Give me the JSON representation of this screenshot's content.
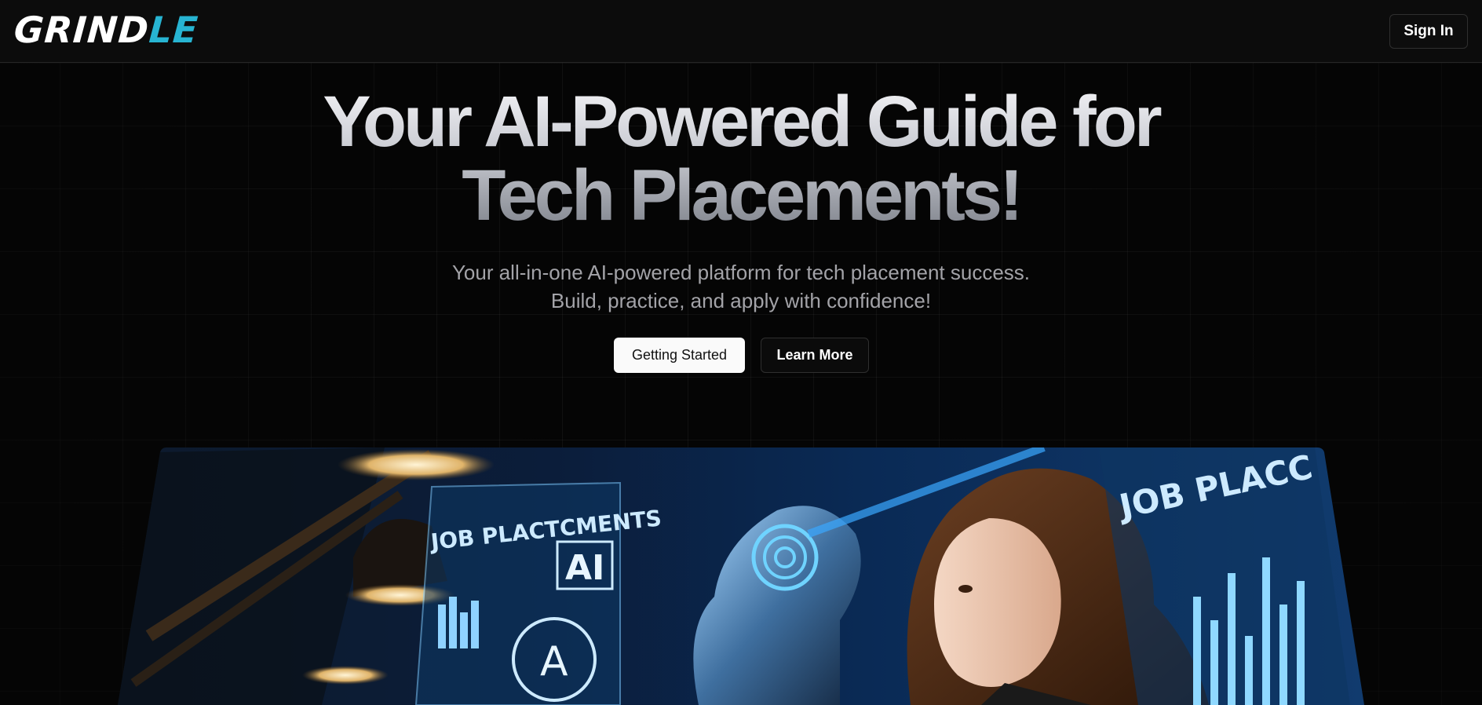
{
  "brand": {
    "logo_part1": "GRIND",
    "logo_part2": "LE",
    "accent": "#27b4d2"
  },
  "header": {
    "sign_in_label": "Sign In"
  },
  "hero": {
    "title_line1": "Your AI-Powered Guide for",
    "title_line2": "Tech Placements!",
    "subtitle_line1": "Your all-in-one AI-powered platform for tech placement success.",
    "subtitle_line2": "Build, practice, and apply with confidence!",
    "primary_button": "Getting Started",
    "secondary_button": "Learn More"
  },
  "illustration": {
    "screen_left_text": "JOB PLACTCMENTS",
    "ai_badge": "AI",
    "ai_circle_letter": "A",
    "screen_right_text": "JOB PLACC"
  }
}
